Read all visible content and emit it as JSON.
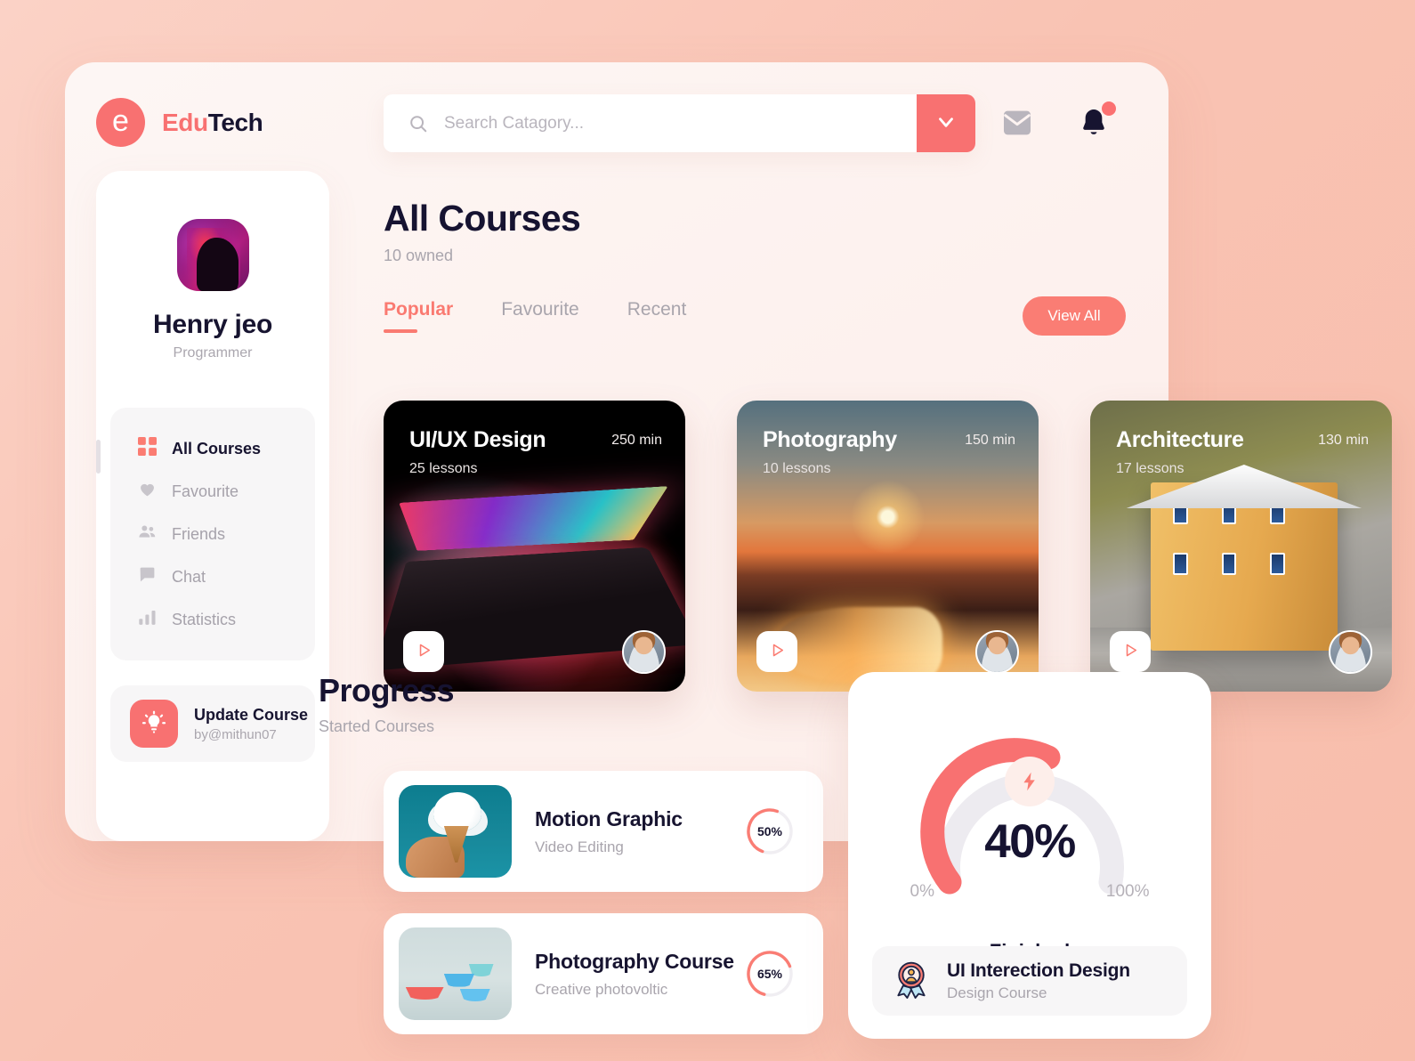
{
  "brand": {
    "mark": "e",
    "name_part1": "Edu",
    "name_part2": "Tech"
  },
  "search": {
    "placeholder": "Search Catagory...",
    "value": "",
    "icon": "search-icon",
    "dropdown_icon": "chevron-down-icon"
  },
  "header": {
    "mail_icon": "envelope-icon",
    "bell_icon": "bell-icon",
    "has_notification": true
  },
  "profile": {
    "name": "Henry jeo",
    "role": "Programmer",
    "avatar": "user-avatar"
  },
  "sidebar": {
    "items": [
      {
        "label": "All Courses",
        "icon": "grid-icon",
        "active": true
      },
      {
        "label": "Favourite",
        "icon": "heart-icon",
        "active": false
      },
      {
        "label": "Friends",
        "icon": "people-icon",
        "active": false
      },
      {
        "label": "Chat",
        "icon": "chat-icon",
        "active": false
      },
      {
        "label": "Statistics",
        "icon": "bar-chart-icon",
        "active": false
      }
    ],
    "update_card": {
      "title": "Update Course",
      "subtitle": "by@mithun07",
      "icon": "lightbulb-icon"
    }
  },
  "main": {
    "title": "All Courses",
    "subtitle": "10 owned",
    "tabs": [
      {
        "label": "Popular",
        "active": true
      },
      {
        "label": "Favourite",
        "active": false
      },
      {
        "label": "Recent",
        "active": false
      }
    ],
    "view_all_label": "View All"
  },
  "courses": [
    {
      "title": "UI/UX Design",
      "lessons": "25 lessons",
      "duration": "250 min",
      "play_icon": "play-icon",
      "avatar": "instructor-avatar"
    },
    {
      "title": "Photography",
      "lessons": "10 lessons",
      "duration": "150 min",
      "play_icon": "play-icon",
      "avatar": "instructor-avatar"
    },
    {
      "title": "Architecture",
      "lessons": "17 lessons",
      "duration": "130 min",
      "play_icon": "play-icon",
      "avatar": "instructor-avatar"
    }
  ],
  "progress": {
    "title": "Progress",
    "subtitle": "Started Courses",
    "items": [
      {
        "title": "Motion Graphic",
        "subtitle": "Video Editing",
        "percent": 50,
        "percent_label": "50%",
        "thumb": "icecream-thumb"
      },
      {
        "title": "Photography Course",
        "subtitle": "Creative photovoltic",
        "percent": 65,
        "percent_label": "65%",
        "thumb": "paperboats-thumb"
      }
    ]
  },
  "gauge": {
    "value": 40,
    "value_label": "40%",
    "min_label": "0%",
    "max_label": "100%",
    "caption": "Finished",
    "bolt_icon": "lightning-bolt-icon",
    "badge": {
      "title": "UI Interection Design",
      "subtitle": "Design Course",
      "icon": "award-badge-icon"
    }
  },
  "colors": {
    "accent": "#f87171",
    "accent_soft": "#fa7d74",
    "dark": "#161331",
    "muted": "#a9a5ad",
    "track": "#eceaef",
    "page_bg": "#f9c3b3"
  }
}
